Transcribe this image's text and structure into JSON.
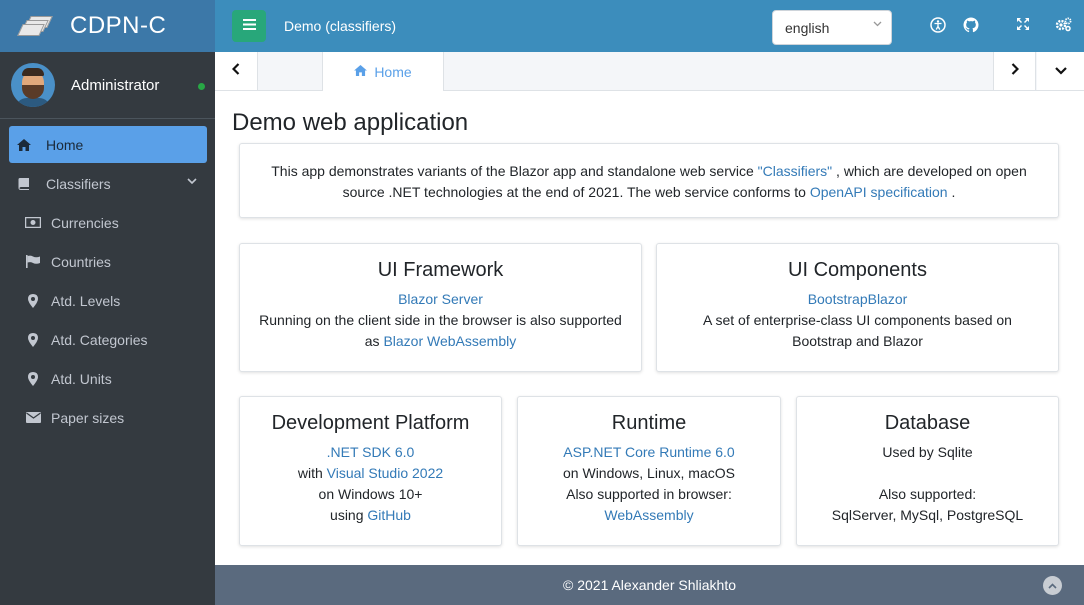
{
  "brand": {
    "title": "CDPN-C"
  },
  "user": {
    "name": "Administrator"
  },
  "sidebar": {
    "items": [
      {
        "label": "Home",
        "icon": "home-icon"
      },
      {
        "label": "Classifiers",
        "icon": "book-icon"
      },
      {
        "label": "Currencies",
        "icon": "money-icon"
      },
      {
        "label": "Countries",
        "icon": "flag-icon"
      },
      {
        "label": "Atd. Levels",
        "icon": "map-marker-icon"
      },
      {
        "label": "Atd. Categories",
        "icon": "map-marker-icon"
      },
      {
        "label": "Atd. Units",
        "icon": "map-marker-icon"
      },
      {
        "label": "Paper sizes",
        "icon": "envelope-icon"
      }
    ]
  },
  "header": {
    "title": "Demo (classifiers)",
    "language": "english"
  },
  "tabs": {
    "home_label": "Home"
  },
  "main": {
    "title": "Demo web application",
    "intro": {
      "text1": "This app demonstrates variants of the Blazor app and standalone web service ",
      "link1": "\"Classifiers\"",
      "text2": " , which are developed on open source .NET technologies at the end of 2021. The web service conforms to ",
      "link2": "OpenAPI specification",
      "text3": " ."
    },
    "cards": {
      "ui_framework": {
        "title": "UI Framework",
        "link1": "Blazor Server",
        "line2": "Running on the client side in the browser is also supported",
        "line3_prefix": "as ",
        "link2": "Blazor WebAssembly"
      },
      "ui_components": {
        "title": "UI Components",
        "link1": "BootstrapBlazor",
        "line2": "A set of enterprise-class UI components based on Bootstrap and Blazor"
      },
      "dev_platform": {
        "title": "Development Platform",
        "link1": ".NET SDK 6.0",
        "line2_prefix": "with ",
        "link2": "Visual Studio 2022",
        "line3": "on Windows 10+",
        "line4_prefix": "using ",
        "link3": "GitHub"
      },
      "runtime": {
        "title": "Runtime",
        "link1": "ASP.NET Core Runtime 6.0",
        "line2": "on Windows, Linux, macOS",
        "line3": "Also supported in browser:",
        "link2": "WebAssembly"
      },
      "database": {
        "title": "Database",
        "line1": "Used by Sqlite",
        "line2": "Also supported:",
        "line3": "SqlServer, MySql, PostgreSQL"
      }
    }
  },
  "footer": {
    "text": "© 2021 Alexander Shliakhto"
  },
  "colors": {
    "sidebar_bg": "#343a40",
    "brand_bg": "#3c78a8",
    "header_bg": "#3c8dbc",
    "active_item": "#5aa0e8",
    "link": "#337ab7",
    "footer_bg": "#5a6a7e"
  }
}
